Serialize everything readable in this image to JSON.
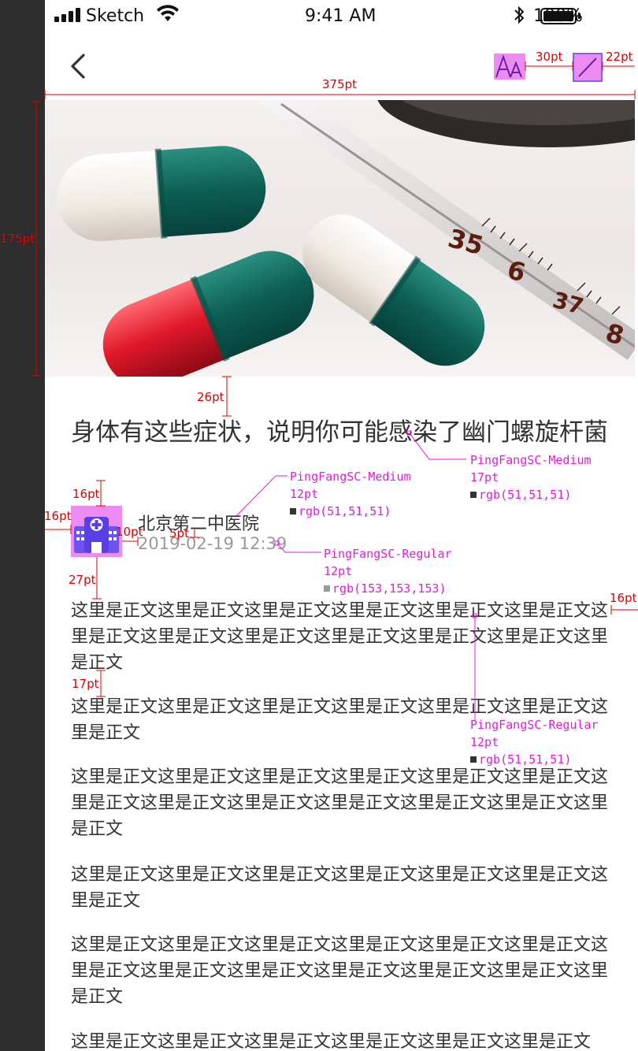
{
  "status_bar": {
    "carrier": "Sketch",
    "time": "9:41 AM",
    "battery": "100%"
  },
  "nav": {
    "back_icon": "chevron-left-icon",
    "font_icon": "font-size-icon",
    "share_icon": "share-icon"
  },
  "article": {
    "title": "身体有这些症状，说明你可能感染了幽门螺旋杆菌",
    "source": "北京第二中医院",
    "date": "2019-02-19 12:39",
    "paragraphs": [
      "这里是正文这里是正文这里是正文这里是正文这里是正文这里是正文这里是正文这里是正文这里是正文这里是正文这里是正文这里是正文这里是正文",
      "这里是正文这里是正文这里是正文这里是正文这里是正文这里是正文这里是正文",
      "这里是正文这里是正文这里是正文这里是正文这里是正文这里是正文这里是正文这里是正文这里是正文这里是正文这里是正文这里是正文这里是正文",
      "这里是正文这里是正文这里是正文这里是正文这里是正文这里是正文这里是正文",
      "这里是正文这里是正文这里是正文这里是正文这里是正文这里是正文这里是正文这里是正文这里是正文这里是正文这里是正文这里是正文这里是正文",
      "这里是正文这里是正文这里是正文这里是正文这里是正文这里是正文"
    ]
  },
  "hero_image": {
    "thermometer_marks": [
      "35",
      "6",
      "37",
      "8"
    ]
  },
  "annotations": {
    "spacing": {
      "icon_gap": "30pt",
      "right_margin": "22pt",
      "screen_width": "375pt",
      "hero_height": "175pt",
      "hero_to_title": "26pt",
      "title_to_avatar": "16pt",
      "left_margin": "16pt",
      "avatar_to_text": "10pt",
      "source_to_date": "5pt",
      "avatar_to_body": "27pt",
      "body_right_margin": "16pt",
      "paragraph_gap": "17pt"
    },
    "title_spec": {
      "font": "PingFangSC-Medium",
      "size": "17pt",
      "color": "rgb(51,51,51)"
    },
    "source_spec": {
      "font": "PingFangSC-Medium",
      "size": "12pt",
      "color": "rgb(51,51,51)"
    },
    "date_spec": {
      "font": "PingFangSC-Regular",
      "size": "12pt",
      "color": "rgb(153,153,153)"
    },
    "body_spec": {
      "font": "PingFangSC-Regular",
      "size": "12pt",
      "color": "rgb(51,51,51)"
    }
  },
  "colors": {
    "text_primary": "#333333",
    "text_secondary": "#999999",
    "annotation_red": "#e00000",
    "annotation_magenta": "#e21be0",
    "placeholder_pink": "#ec8cf0"
  }
}
